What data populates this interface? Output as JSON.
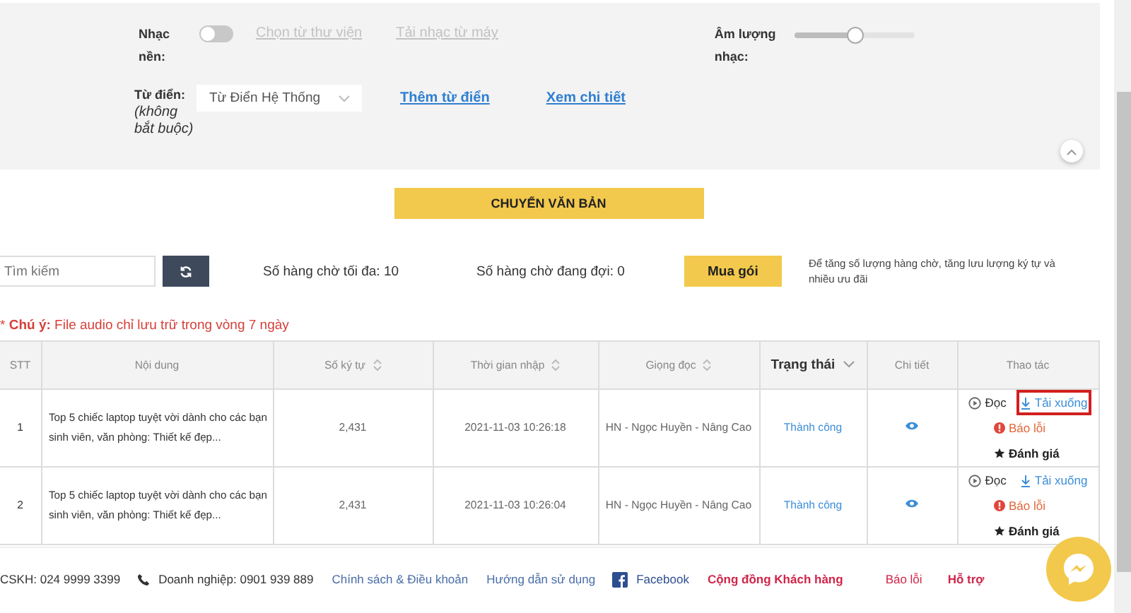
{
  "settings": {
    "music_label": "Nhạc nền:",
    "music_toggle": {
      "on": false
    },
    "music_links": [
      {
        "label": "Chọn từ thư viện",
        "disabled": true
      },
      {
        "label": "Tải nhạc từ máy",
        "disabled": true
      }
    ],
    "volume_label": "Âm lượng nhạc:",
    "volume": {
      "level": 0.5
    },
    "dictionary_label": "Từ điển:",
    "dictionary_hint": "(không bắt buộc)",
    "dictionary_select": "Từ Điển Hệ Thống",
    "dictionary_links": [
      {
        "label": "Thêm từ điển",
        "disabled": false
      },
      {
        "label": "Xem chi tiết",
        "disabled": false
      }
    ]
  },
  "convert_button": "CHUYỂN VĂN BẢN",
  "toolbar": {
    "search": {
      "placeholder": "Tìm kiếm"
    },
    "max_queue": "Số hàng chờ tối đa: 10",
    "waiting_queue": "Số hàng chờ đang đợi: 0",
    "buy_button": "Mua gói",
    "buy_note": "Để tăng số lượng hàng chờ, tăng lưu lượng ký tự và nhiều ưu đãi"
  },
  "notice": "* **Chú ý:** File audio chỉ lưu trữ trong vòng 7 ngày",
  "table": {
    "columns": [
      {
        "label": "STT",
        "sortable": false,
        "filter": false
      },
      {
        "label": "Nội dung",
        "sortable": false,
        "filter": false
      },
      {
        "label": "Số ký tự",
        "sortable": true,
        "filter": false
      },
      {
        "label": "Thời gian nhập",
        "sortable": true,
        "filter": false
      },
      {
        "label": "Giọng đọc",
        "sortable": true,
        "filter": false
      },
      {
        "label": "Trạng thái",
        "sortable": false,
        "filter": true
      },
      {
        "label": "Chi tiết",
        "sortable": false,
        "filter": false
      },
      {
        "label": "Thao tác",
        "sortable": false,
        "filter": false
      }
    ],
    "rows": [
      {
        "stt": "1",
        "content": "Top 5 chiếc laptop tuyệt vời dành cho các bạn sinh viên, văn phòng: Thiết kế đẹp...",
        "chars": "2,431",
        "time": "2021-11-03 10:26:18",
        "voice": "HN - Ngọc Huyền - Nâng Cao",
        "status": "Thành công",
        "actions": [
          {
            "kind": "play",
            "label": "Đọc",
            "highlighted": false
          },
          {
            "kind": "download",
            "label": "Tải xuống",
            "highlighted": true
          },
          {
            "kind": "report",
            "label": "Báo lỗi",
            "highlighted": false
          },
          {
            "kind": "rate",
            "label": "Đánh giá",
            "highlighted": false
          }
        ]
      },
      {
        "stt": "2",
        "content": "Top 5 chiếc laptop tuyệt vời dành cho các bạn sinh viên, văn phòng: Thiết kế đẹp...",
        "chars": "2,431",
        "time": "2021-11-03 10:26:04",
        "voice": "HN - Ngọc Huyền - Nâng Cao",
        "status": "Thành công",
        "actions": [
          {
            "kind": "play",
            "label": "Đọc",
            "highlighted": false
          },
          {
            "kind": "download",
            "label": "Tải xuống",
            "highlighted": false
          },
          {
            "kind": "report",
            "label": "Báo lỗi",
            "highlighted": false
          },
          {
            "kind": "rate",
            "label": "Đánh giá",
            "highlighted": false
          }
        ]
      }
    ]
  },
  "footer": [
    {
      "kind": "text",
      "label": "CSKH: 024 9999 3399"
    },
    {
      "kind": "phone",
      "label": "Doanh nghiệp: 0901 939 889"
    },
    {
      "kind": "link",
      "label": "Chính sách & Điều khoản"
    },
    {
      "kind": "link",
      "label": "Hướng dẫn sử dụng"
    },
    {
      "kind": "facebook",
      "label": "Facebook"
    },
    {
      "kind": "community",
      "label": "Cộng đồng Khách hàng"
    },
    {
      "kind": "report",
      "label": "Báo lỗi"
    },
    {
      "kind": "support",
      "label": "Hỗ trợ"
    }
  ]
}
